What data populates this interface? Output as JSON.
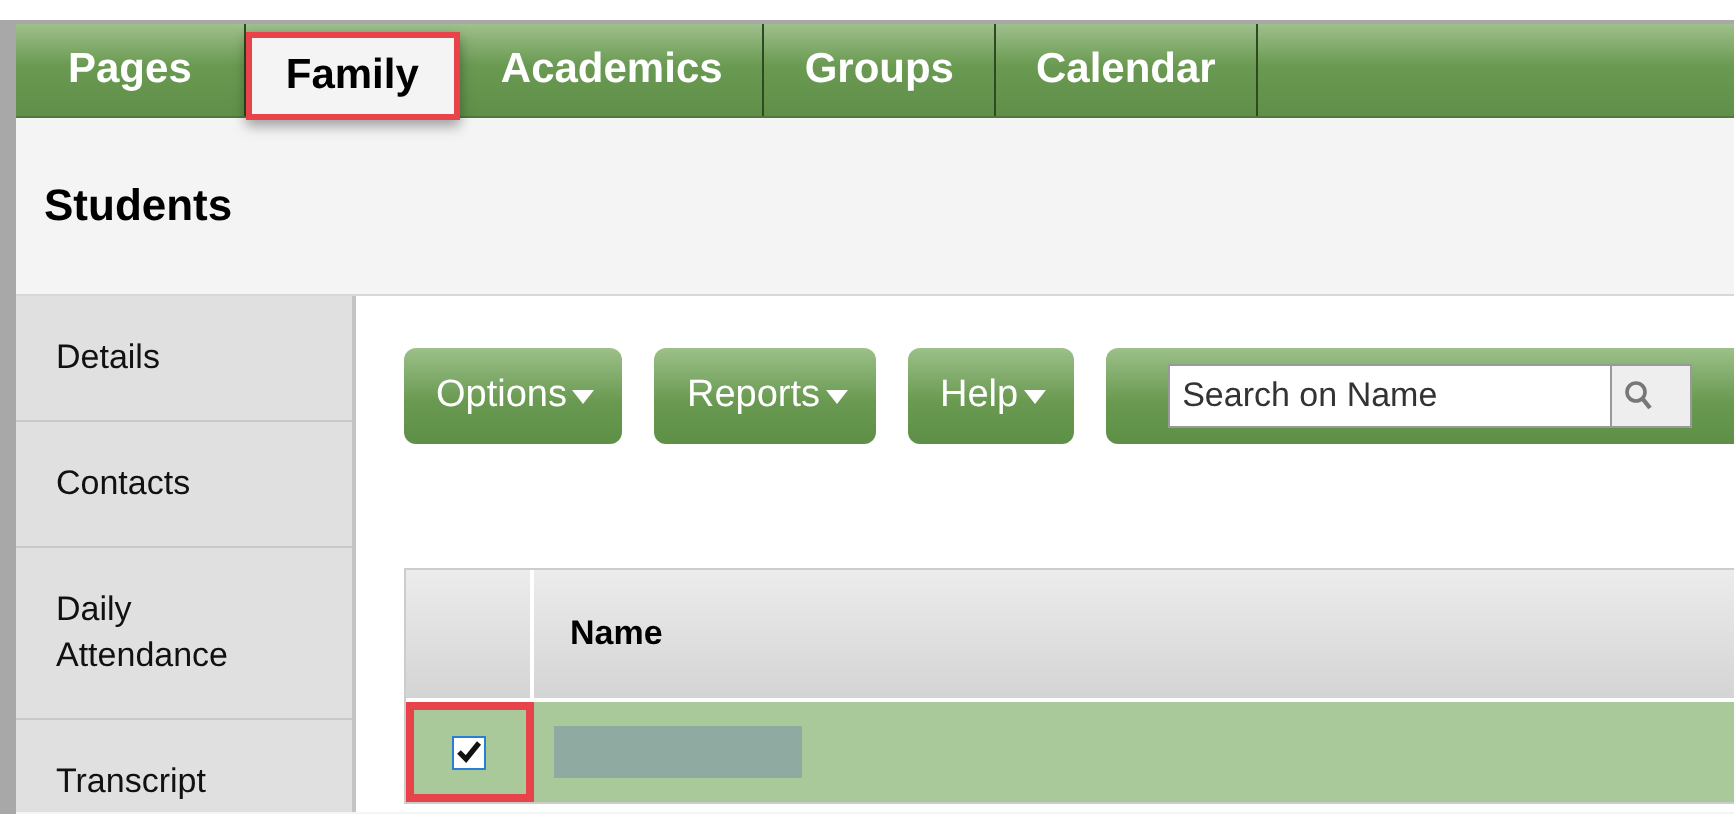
{
  "tabs": [
    {
      "label": "Pages",
      "selected": false,
      "highlighted": false
    },
    {
      "label": "Family",
      "selected": true,
      "highlighted": true
    },
    {
      "label": "Academics",
      "selected": false,
      "highlighted": false
    },
    {
      "label": "Groups",
      "selected": false,
      "highlighted": false
    },
    {
      "label": "Calendar",
      "selected": false,
      "highlighted": false
    }
  ],
  "page_title": "Students",
  "sidebar": {
    "items": [
      {
        "label": "Details",
        "selected": false
      },
      {
        "label": "Contacts",
        "selected": false
      },
      {
        "label": "Daily Attendance",
        "selected": false
      },
      {
        "label": "Transcript",
        "selected": false
      }
    ]
  },
  "toolbar": {
    "buttons": [
      {
        "label": "Options"
      },
      {
        "label": "Reports"
      },
      {
        "label": "Help"
      }
    ],
    "search": {
      "placeholder": "Search on Name"
    }
  },
  "table": {
    "columns": [
      "Name"
    ],
    "rows": [
      {
        "checked": true,
        "highlighted": true,
        "selected": true,
        "name_redacted": true
      }
    ]
  }
}
